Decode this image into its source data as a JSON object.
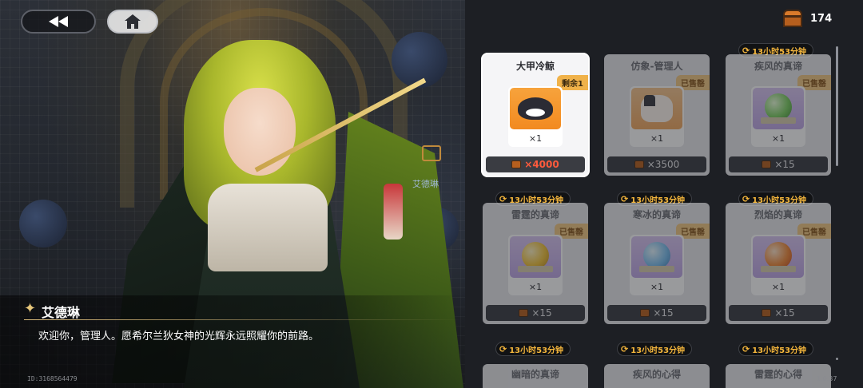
{
  "nav": {
    "back_icon": "double-chevron-left-icon",
    "home_icon": "home-icon"
  },
  "currency": {
    "icon": "treasure-chest-icon",
    "amount": "174"
  },
  "npc": {
    "name": "艾德琳",
    "speech": "欢迎你，管理人。愿希尔兰狄女神的光辉永远照耀你的前路。",
    "side_tag": "艾德琳"
  },
  "footer": {
    "user_id": "ID:3168564479",
    "version": "1.0.37"
  },
  "cards": [
    {
      "title": "大甲冷鲸",
      "badge": "剩余1",
      "qty": "×1",
      "price": "×4000",
      "sold": false,
      "timer": ""
    },
    {
      "title": "仿象-管理人",
      "badge": "已售罄",
      "qty": "×1",
      "price": "×3500",
      "sold": true,
      "timer": ""
    },
    {
      "title": "疾风的真谛",
      "badge": "已售罄",
      "qty": "×1",
      "price": "×15",
      "sold": true,
      "timer": "13小时53分钟"
    },
    {
      "title": "雷霆的真谛",
      "badge": "已售罄",
      "qty": "×1",
      "price": "×15",
      "sold": true,
      "timer": "13小时53分钟"
    },
    {
      "title": "寒冰的真谛",
      "badge": "已售罄",
      "qty": "×1",
      "price": "×15",
      "sold": true,
      "timer": "13小时53分钟"
    },
    {
      "title": "烈焰的真谛",
      "badge": "已售罄",
      "qty": "×1",
      "price": "×15",
      "sold": true,
      "timer": "13小时53分钟"
    }
  ],
  "partial_cards": [
    {
      "title": "幽暗的真谛",
      "timer": "13小时53分钟"
    },
    {
      "title": "疾风的心得",
      "timer": "13小时53分钟"
    },
    {
      "title": "雷霆的心得",
      "timer": "13小时53分钟"
    }
  ],
  "colors": {
    "accent_orange": "#f0b24a",
    "price_red": "#ff5a3c",
    "timer_gold": "#f6b73c"
  }
}
